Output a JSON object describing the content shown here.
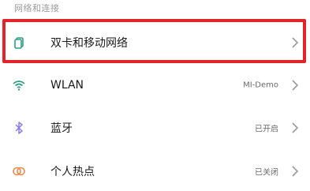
{
  "section": {
    "title": "网络和连接"
  },
  "items": [
    {
      "label": "双卡和移动网络",
      "value": "",
      "icon": "sim-cards-icon"
    },
    {
      "label": "WLAN",
      "value": "MI-Demo",
      "icon": "wifi-icon"
    },
    {
      "label": "蓝牙",
      "value": "已开启",
      "icon": "bluetooth-icon"
    },
    {
      "label": "个人热点",
      "value": "已关闭",
      "icon": "hotspot-icon"
    }
  ],
  "colors": {
    "accent_green": "#2e9d86",
    "bluetooth_purple": "#8a7cf0",
    "hotspot_orange": "#f08a4b",
    "highlight_red": "#e3242b"
  }
}
